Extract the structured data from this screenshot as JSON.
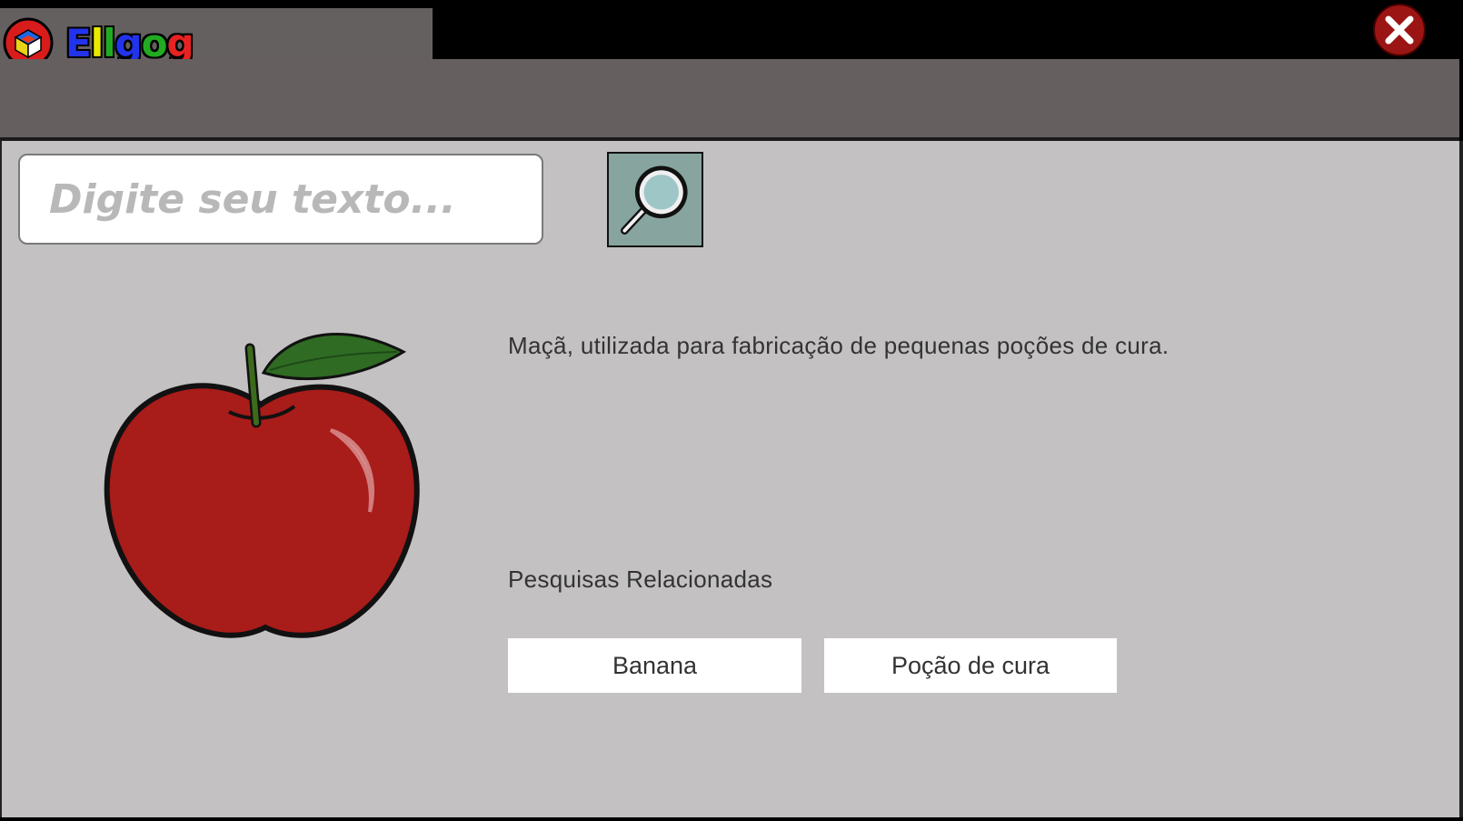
{
  "app": {
    "brand_letters": [
      "E",
      "l",
      "l",
      "g",
      "o",
      "g"
    ],
    "logo_icon": "cube-logo-icon",
    "close_icon": "close-icon"
  },
  "search": {
    "placeholder": "Digite seu texto...",
    "value": "",
    "button_icon": "magnifier-icon"
  },
  "result": {
    "image": "apple-image",
    "description": "Maçã, utilizada para fabricação de pequenas poções de cura."
  },
  "related": {
    "title": "Pesquisas Relacionadas",
    "items": [
      {
        "label": "Banana"
      },
      {
        "label": "Poção de cura"
      }
    ]
  },
  "colors": {
    "chrome": "#656060",
    "content_bg": "#c3c1c2",
    "search_button": "#87a59e",
    "apple_red": "#a81c1a",
    "leaf_green": "#2f6b23"
  }
}
